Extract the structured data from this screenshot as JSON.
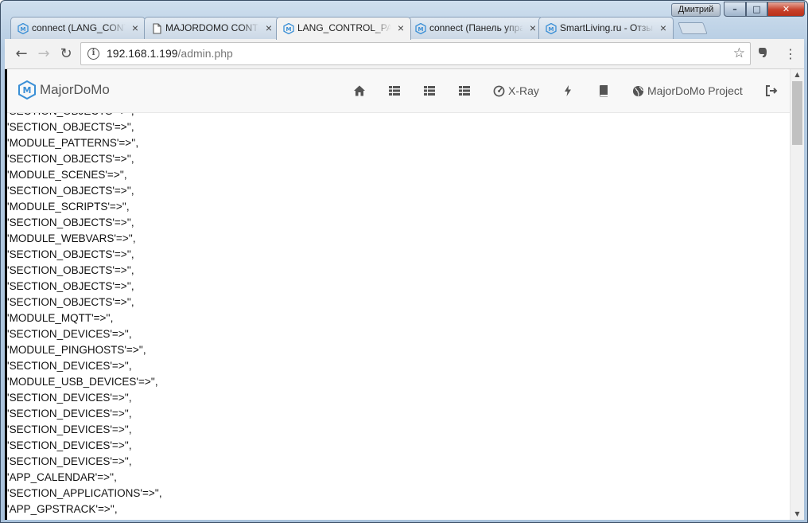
{
  "window": {
    "user_name": "Дмитрий",
    "minimize_glyph": "–",
    "maximize_glyph": "□",
    "close_glyph": "✕"
  },
  "tabs": [
    {
      "label": "connect (LANG_CONTROL_PANEL)",
      "favicon": "majordomo-favicon"
    },
    {
      "label": "MAJORDOMO CONTROL",
      "favicon": "document-icon"
    },
    {
      "label": "LANG_CONTROL_PANEL",
      "favicon": "majordomo-favicon",
      "active": true
    },
    {
      "label": "connect (Панель управления)",
      "favicon": "majordomo-favicon"
    },
    {
      "label": "SmartLiving.ru - Отзывы",
      "favicon": "majordomo-favicon"
    }
  ],
  "tab_close_glyph": "×",
  "toolbar": {
    "back_glyph": "←",
    "forward_glyph": "→",
    "reload_glyph": "↻",
    "info_glyph": "i",
    "url_host": "192.168.1.199",
    "url_path": "/admin.php",
    "star_glyph": "☆",
    "extension_icon": "evernote-icon",
    "menu_glyph": "⋮"
  },
  "app": {
    "brand_name": "MajorDoMo",
    "nav": [
      {
        "icon": "home-icon",
        "label": ""
      },
      {
        "icon": "list-icon",
        "label": ""
      },
      {
        "icon": "list-icon",
        "label": ""
      },
      {
        "icon": "list-icon",
        "label": ""
      },
      {
        "icon": "dashboard-icon",
        "label": "X-Ray"
      },
      {
        "icon": "flash-icon",
        "label": ""
      },
      {
        "icon": "book-icon",
        "label": ""
      },
      {
        "icon": "globe-icon",
        "label": "MajorDoMo Project"
      },
      {
        "icon": "logout-icon",
        "label": ""
      }
    ]
  },
  "content_lines": [
    "'SECTION_OBJECTS'=>'',",
    "'SECTION_OBJECTS'=>'',",
    "'MODULE_PATTERNS'=>'',",
    "'SECTION_OBJECTS'=>'',",
    "'MODULE_SCENES'=>'',",
    "'SECTION_OBJECTS'=>'',",
    "'MODULE_SCRIPTS'=>'',",
    "'SECTION_OBJECTS'=>'',",
    "'MODULE_WEBVARS'=>'',",
    "'SECTION_OBJECTS'=>'',",
    "'SECTION_OBJECTS'=>'',",
    "'SECTION_OBJECTS'=>'',",
    "'SECTION_OBJECTS'=>'',",
    "'MODULE_MQTT'=>'',",
    "'SECTION_DEVICES'=>'',",
    "'MODULE_PINGHOSTS'=>'',",
    "'SECTION_DEVICES'=>'',",
    "'MODULE_USB_DEVICES'=>'',",
    "'SECTION_DEVICES'=>'',",
    "'SECTION_DEVICES'=>'',",
    "'SECTION_DEVICES'=>'',",
    "'SECTION_DEVICES'=>'',",
    "'SECTION_DEVICES'=>'',",
    "'APP_CALENDAR'=>'',",
    "'SECTION_APPLICATIONS'=>'',",
    "'APP_GPSTRACK'=>'',"
  ],
  "scrollbar": {
    "up_glyph": "▲",
    "down_glyph": "▼"
  }
}
